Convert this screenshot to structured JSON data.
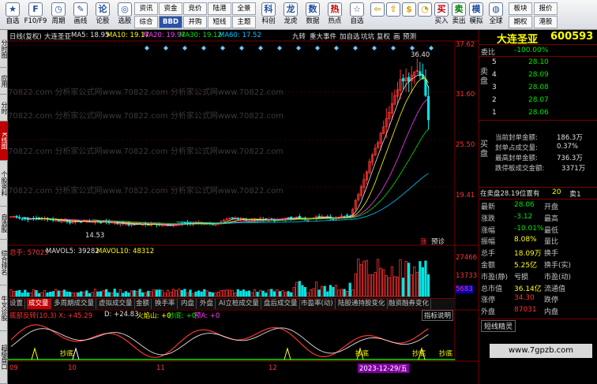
{
  "toolbar": {
    "buttons": [
      {
        "label": "自选",
        "icon": "star-icon"
      },
      {
        "label": "F10/F9",
        "icon": "info-icon"
      },
      {
        "label": "周期",
        "icon": "clock-icon"
      },
      {
        "label": "画线",
        "icon": "pencil-icon"
      },
      {
        "label": "论股",
        "icon": "talk-icon"
      },
      {
        "label": "选股",
        "icon": "filter-icon"
      }
    ],
    "small_top": [
      "资讯",
      "资金",
      "竞价",
      "陆港",
      "全景"
    ],
    "small_bottom": [
      "综合",
      "BBD",
      "并购",
      "短线",
      "主题"
    ],
    "buttons2": [
      {
        "label": "科创",
        "icon": "chip-icon"
      },
      {
        "label": "龙虎",
        "icon": "dragon-icon"
      },
      {
        "label": "数据",
        "icon": "data-icon"
      },
      {
        "label": "热点",
        "icon": "fire-icon"
      },
      {
        "label": "自选",
        "icon": "star-icon"
      }
    ],
    "buttons3": [
      {
        "label": "",
        "icon": "arrow-up-icon"
      },
      {
        "label": "",
        "icon": "arrow-down-icon"
      },
      {
        "label": "",
        "icon": "money-icon"
      },
      {
        "label": "",
        "icon": "clock-icon"
      },
      {
        "label": "买入",
        "icon": "buy-icon"
      },
      {
        "label": "卖出",
        "icon": "sell-icon"
      },
      {
        "label": "模拟",
        "icon": "simulate-icon"
      },
      {
        "label": "全球",
        "icon": "globe-icon"
      }
    ],
    "right_small_top": [
      "板块",
      "报价"
    ],
    "right_small_bottom": [
      "期权",
      "港股"
    ]
  },
  "leftstrip": [
    "分时图",
    "应用",
    "分时",
    "K线图",
    "个股资料",
    "自选股",
    "综合排名",
    "牛叉诊股",
    "超级盘口"
  ],
  "chart": {
    "period": "日线(复权)",
    "stock": "大连圣亚",
    "ma": [
      {
        "label": "MA5: 18.95",
        "color": "#e0e0e0"
      },
      {
        "label": "MA10: 19.17",
        "color": "#ffff00"
      },
      {
        "label": "MA20: 19.97",
        "color": "#ff3cff"
      },
      {
        "label": "MA30: 19.12",
        "color": "#00e600"
      },
      {
        "label": "MA60: 17.52",
        "color": "#00c8ff"
      }
    ],
    "top_tabs": [
      "九转",
      "重大事件",
      "加自选",
      "坑坑",
      "复权",
      "画",
      "预测"
    ],
    "price_axis": [
      "37.62",
      "31.60",
      "25.50",
      "19.41"
    ],
    "high_label": "36.40",
    "low_label": "14.53",
    "bottom_tags": [
      "涨",
      "预诊"
    ],
    "volume_legend": [
      "总手: 57025",
      "MAVOL5: 39282",
      "MAVOL10: 48312"
    ],
    "volume_axis": [
      "27466",
      "13733",
      "5683"
    ],
    "sub_tabs": [
      "设置",
      "成交量",
      "多周期成交量",
      "虚拟成交量",
      "金额",
      "换手率",
      "内盘",
      "外盘",
      "AI立桩成交量",
      "盘后成交量",
      "市盈率(动)",
      "陆股通持股变化",
      "融资融券变化"
    ],
    "sub_tab_active": "成交量",
    "indicator_legend": [
      "底部反转(10.3) X: +45.29",
      "D: +24.83",
      "火焰山: +0",
      "抄底: +0",
      "预A: +0"
    ],
    "indicator_button": "指标说明",
    "indicator_tags": [
      "抄底",
      "抄底",
      "抄底",
      "抄底"
    ],
    "date_axis": [
      "09",
      "10",
      "11",
      "12"
    ],
    "date_cursor": "2023-12-29/五",
    "watermark": "70822.com 分析家公式网www.70822.com 分析家公式网www.70822.com"
  },
  "quote": {
    "name": "大连圣亚",
    "code": "600593",
    "webi_label": "委比",
    "webi": "-100.00%",
    "sell_label": "卖盘",
    "sell": [
      {
        "n": "5",
        "price": "28.10"
      },
      {
        "n": "4",
        "price": "28.09"
      },
      {
        "n": "3",
        "price": "28.08"
      },
      {
        "n": "2",
        "price": "28.07"
      },
      {
        "n": "1",
        "price": "28.06"
      }
    ],
    "buy_label": "买盘",
    "seal_info": [
      {
        "label": "当前封单金额:",
        "value": "186.3万"
      },
      {
        "label": "封单占成交量:",
        "value": "0.37%"
      },
      {
        "label": "最高封单金额:",
        "value": "736.3万"
      },
      {
        "label": "跌停板成交金额:",
        "value": "3371万"
      }
    ],
    "pos_line": {
      "label": "在卖盘",
      "price": "28.19",
      "pos": "位置有",
      "count": "20",
      "sell1": "卖1"
    },
    "stats": [
      {
        "l1": "最新",
        "v1": "28.06",
        "c1": "green",
        "l2": "开盘",
        "v2": "",
        "c2": "white"
      },
      {
        "l1": "涨跌",
        "v1": "-3.12",
        "c1": "green",
        "l2": "最高",
        "v2": "",
        "c2": "white"
      },
      {
        "l1": "涨幅",
        "v1": "-10.01%",
        "c1": "green",
        "l2": "最低",
        "v2": "",
        "c2": "white"
      },
      {
        "l1": "振幅",
        "v1": "8.08%",
        "c1": "yellow",
        "l2": "量比",
        "v2": "",
        "c2": "white"
      },
      {
        "l1": "总手",
        "v1": "18.09万",
        "c1": "yellow",
        "l2": "换手",
        "v2": "",
        "c2": "white"
      },
      {
        "l1": "金额",
        "v1": "5.25亿",
        "c1": "yellow",
        "l2": "换手(实)",
        "v2": "",
        "c2": "white"
      },
      {
        "l1": "市盈(静)",
        "v1": "亏损",
        "c1": "white",
        "l2": "市盈(动)",
        "v2": "",
        "c2": "white"
      },
      {
        "l1": "总市值",
        "v1": "36.14亿",
        "c1": "yellow",
        "l2": "流通值",
        "v2": "",
        "c2": "white"
      },
      {
        "l1": "涨停",
        "v1": "34.30",
        "c1": "red",
        "l2": "跌停",
        "v2": "",
        "c2": "white"
      },
      {
        "l1": "外盘",
        "v1": "87031",
        "c1": "red",
        "l2": "内盘",
        "v2": "",
        "c2": "white"
      }
    ],
    "footer_tab": "短线精灵",
    "ad": "www.7gpzb.com"
  }
}
